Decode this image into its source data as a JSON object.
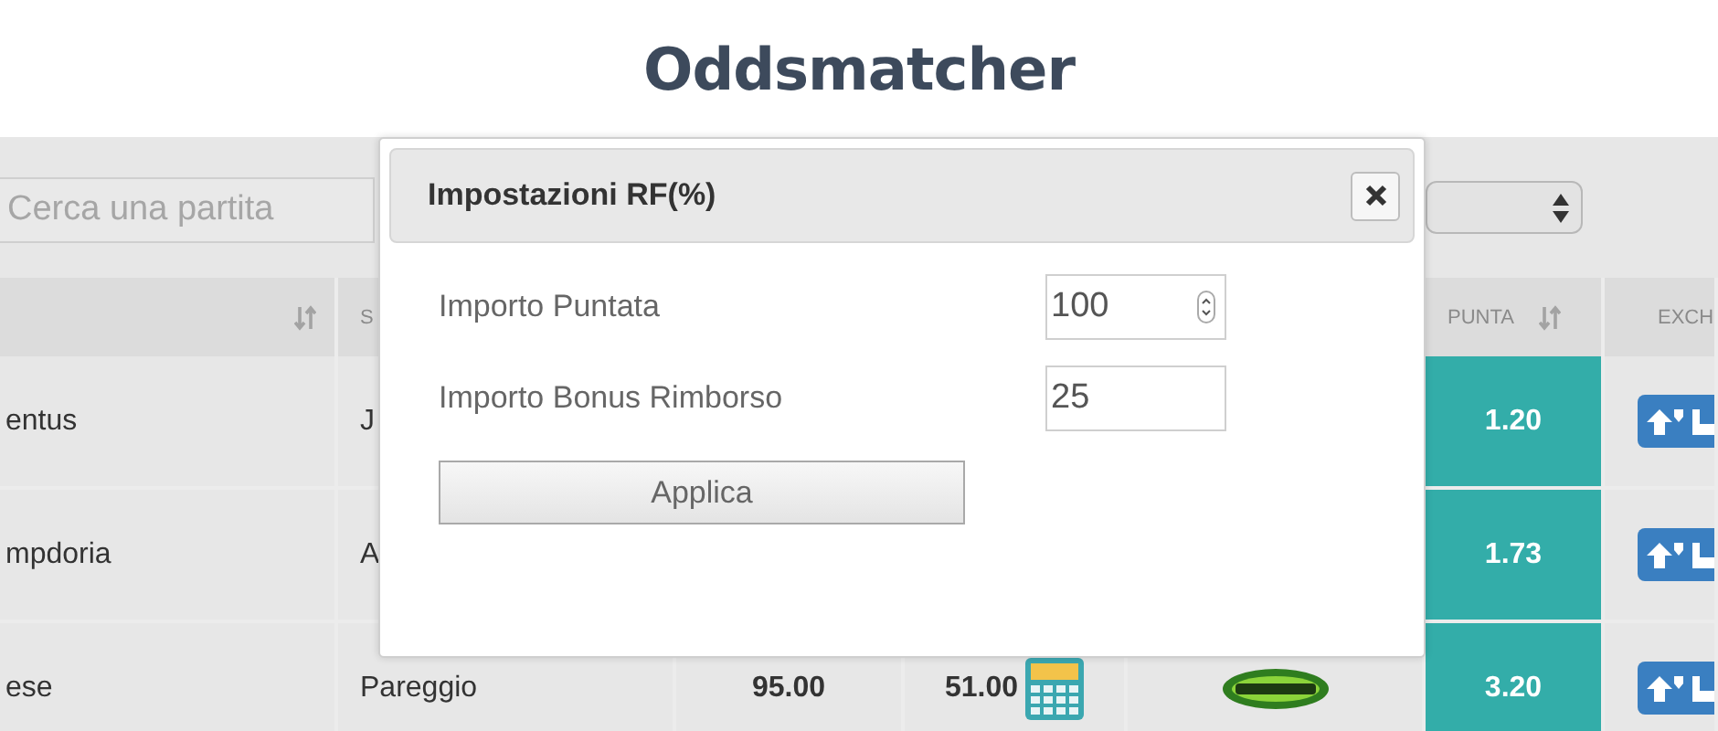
{
  "title": "Oddsmatcher",
  "search": {
    "placeholder": "Cerca una partita"
  },
  "header": {
    "column_2": "S",
    "punta": "PUNTA",
    "column_7": "EXCH"
  },
  "rows": [
    {
      "kind": "covered",
      "column_1": "entus",
      "column_2": "J",
      "punta": "1.20"
    },
    {
      "kind": "covered",
      "column_1": "mpdoria",
      "column_2": "A",
      "punta": "1.73"
    },
    {
      "kind": "full",
      "column_1": "ese",
      "column_2": "Pareggio",
      "column_3": "95.00",
      "column_4": "51.00",
      "punta": "3.20"
    }
  ],
  "modal": {
    "title": "Impostazioni RF(%)",
    "fields": [
      {
        "label": "Importo Puntata",
        "value": "100",
        "kind": "number"
      },
      {
        "label": "Importo Bonus Rimborso",
        "value": "25",
        "kind": "text"
      }
    ],
    "button": "Applica"
  }
}
